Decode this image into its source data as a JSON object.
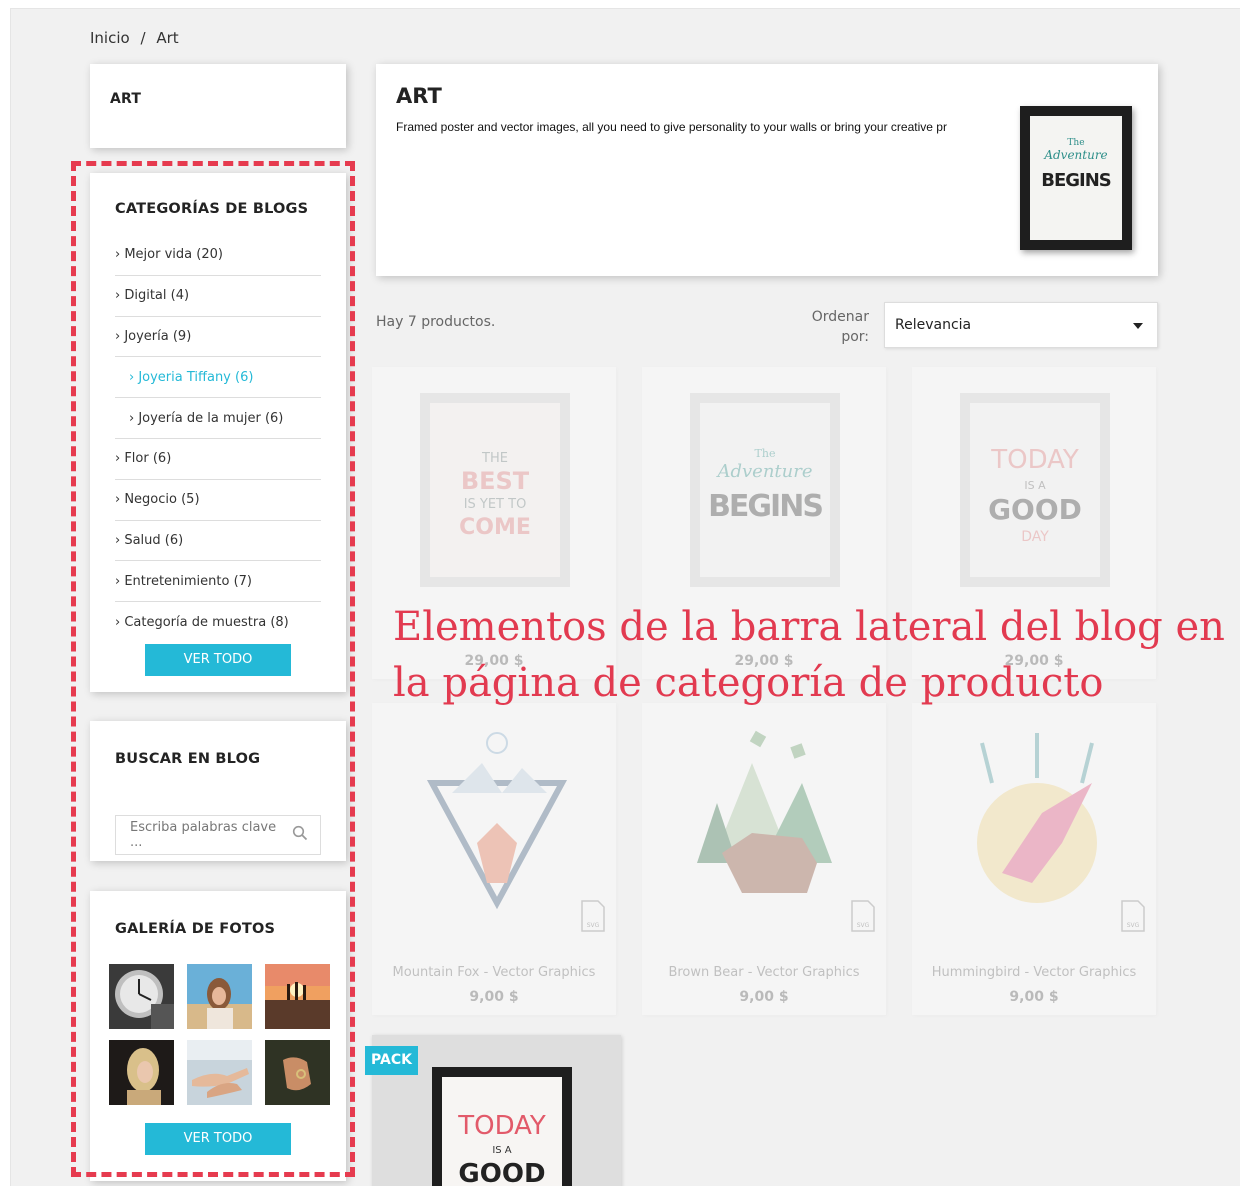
{
  "breadcrumb": {
    "home": "Inicio",
    "separator": "/",
    "current": "Art"
  },
  "sidebar": {
    "art_title": "ART",
    "categories_title": "CATEGORÍAS DE BLOGS",
    "categories": [
      {
        "label": "› Mejor vida (20)",
        "level": 0,
        "active": false
      },
      {
        "label": "› Digital (4)",
        "level": 0,
        "active": false
      },
      {
        "label": "› Joyería (9)",
        "level": 0,
        "active": false
      },
      {
        "label": "› Joyeria Tiffany (6)",
        "level": 1,
        "active": true
      },
      {
        "label": "› Joyería de la mujer (6)",
        "level": 1,
        "active": false
      },
      {
        "label": "› Flor (6)",
        "level": 0,
        "active": false
      },
      {
        "label": "› Negocio (5)",
        "level": 0,
        "active": false
      },
      {
        "label": "› Salud (6)",
        "level": 0,
        "active": false
      },
      {
        "label": "› Entretenimiento (7)",
        "level": 0,
        "active": false
      },
      {
        "label": "› Categoría de muestra (8)",
        "level": 0,
        "active": false
      }
    ],
    "categories_button": "VER TODO",
    "search_title": "BUSCAR EN BLOG",
    "search_placeholder": "Escriba palabras clave ...",
    "gallery_title": "GALERÍA DE FOTOS",
    "gallery_button": "VER TODO"
  },
  "category_header": {
    "title": "ART",
    "description": "Framed poster and vector images, all you need to give personality to your walls or bring your creative pr",
    "poster_line1": "The",
    "poster_line2": "Adventure",
    "poster_line3": "BEGINS"
  },
  "toolbar": {
    "count_text": "Hay 7 productos.",
    "sort_label_1": "Ordenar",
    "sort_label_2": "por:",
    "sort_value": "Relevancia"
  },
  "products": [
    {
      "name": "",
      "price": "29,00 $",
      "poster": [
        "THE",
        "BEST",
        "IS YET TO",
        "COME"
      ]
    },
    {
      "name": "",
      "price": "29,00 $",
      "poster": [
        "The",
        "Adventure",
        "BEGINS",
        ""
      ]
    },
    {
      "name": "",
      "price": "29,00 $",
      "poster": [
        "TODAY",
        "IS A",
        "GOOD",
        "DAY"
      ]
    },
    {
      "name": "Mountain Fox - Vector Graphics",
      "price": "9,00 $"
    },
    {
      "name": "Brown Bear - Vector Graphics",
      "price": "9,00 $"
    },
    {
      "name": "Hummingbird - Vector Graphics",
      "price": "9,00 $"
    }
  ],
  "pack_product": {
    "badge": "PACK",
    "poster": [
      "TODAY",
      "IS A",
      "GOOD"
    ]
  },
  "overlay": {
    "line1": "Elementos de la barra lateral del blog en",
    "line2": "la página de categoría de producto"
  },
  "colors": {
    "accent": "#24b9d7",
    "overlay": "#e23a50",
    "background": "#f1f1f1"
  }
}
